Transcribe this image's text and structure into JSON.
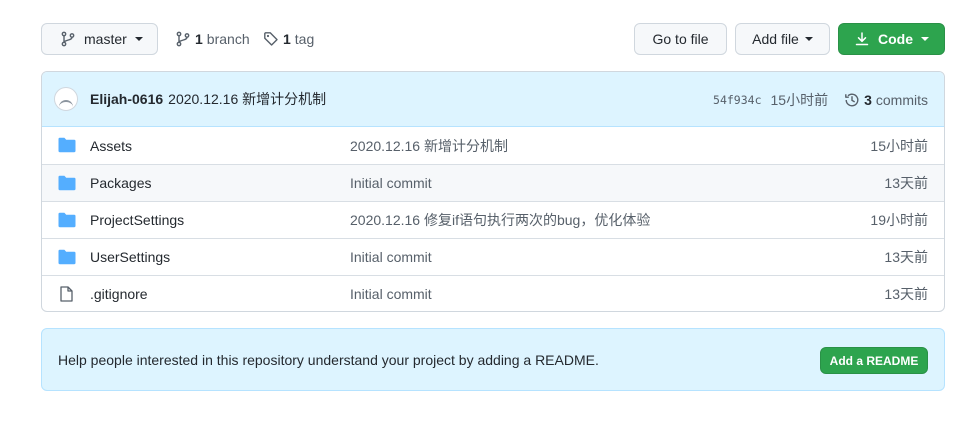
{
  "toolbar": {
    "branch": "master",
    "branch_count": "1",
    "branch_label": "branch",
    "tag_count": "1",
    "tag_label": "tag",
    "go_to_file": "Go to file",
    "add_file": "Add file",
    "code": "Code"
  },
  "commit": {
    "author": "Elijah-0616",
    "message": "2020.12.16 新增计分机制",
    "sha": "54f934c",
    "age": "15小时前",
    "commit_count": "3",
    "commit_label": "commits"
  },
  "files": [
    {
      "name": "Assets",
      "type": "folder",
      "message": "2020.12.16 新增计分机制",
      "age": "15小时前"
    },
    {
      "name": "Packages",
      "type": "folder",
      "message": "Initial commit",
      "age": "13天前"
    },
    {
      "name": "ProjectSettings",
      "type": "folder",
      "message": "2020.12.16 修复if语句执行两次的bug，优化体验",
      "age": "19小时前"
    },
    {
      "name": "UserSettings",
      "type": "folder",
      "message": "Initial commit",
      "age": "13天前"
    },
    {
      "name": ".gitignore",
      "type": "file",
      "message": "Initial commit",
      "age": "13天前"
    }
  ],
  "readme": {
    "text": "Help people interested in this repository understand your project by adding a README.",
    "button": "Add a README"
  },
  "colors": {
    "accent_green": "#2da44e",
    "folder_blue": "#54aeff",
    "banner_blue": "#ddf4ff"
  },
  "icons": [
    "git-branch-icon",
    "tag-icon",
    "download-icon",
    "history-icon",
    "folder-icon",
    "file-icon"
  ]
}
